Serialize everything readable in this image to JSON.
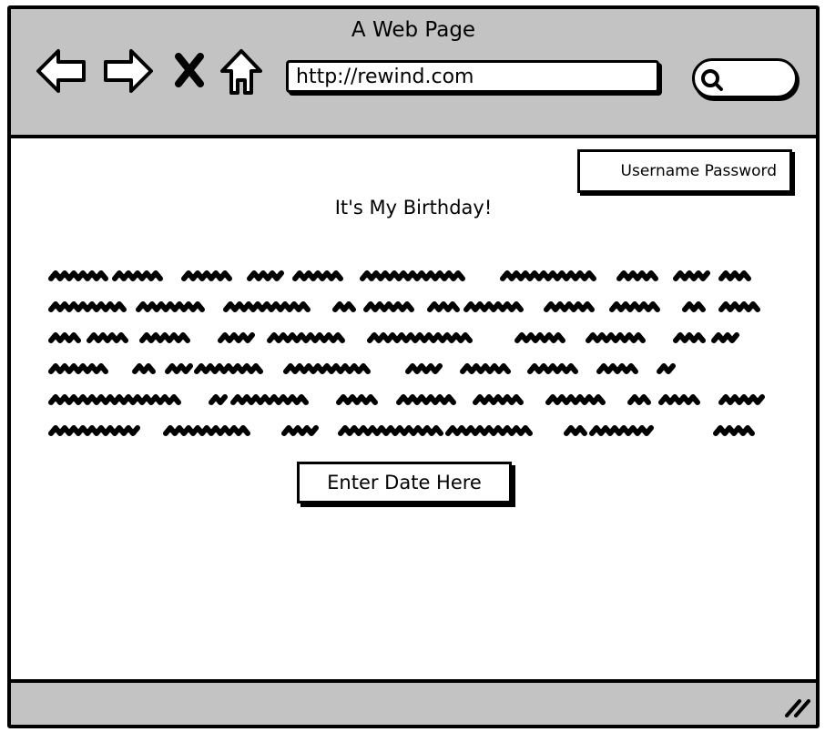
{
  "window": {
    "title": "A Web Page"
  },
  "toolbar": {
    "back_icon": "back-arrow-icon",
    "forward_icon": "forward-arrow-icon",
    "stop_icon": "close-x-icon",
    "home_icon": "home-icon",
    "search_icon": "search-icon"
  },
  "address_bar": {
    "url": "http://rewind.com"
  },
  "login": {
    "label": "Username Password"
  },
  "page": {
    "heading": "It's My Birthday!",
    "body_placeholder": "scribbled-paragraph",
    "date_button_label": "Enter Date Here"
  },
  "statusbar": {
    "resize_icon": "resize-grip-icon"
  },
  "colors": {
    "chrome": "#c3c3c3",
    "ink": "#000000",
    "surface": "#ffffff"
  }
}
